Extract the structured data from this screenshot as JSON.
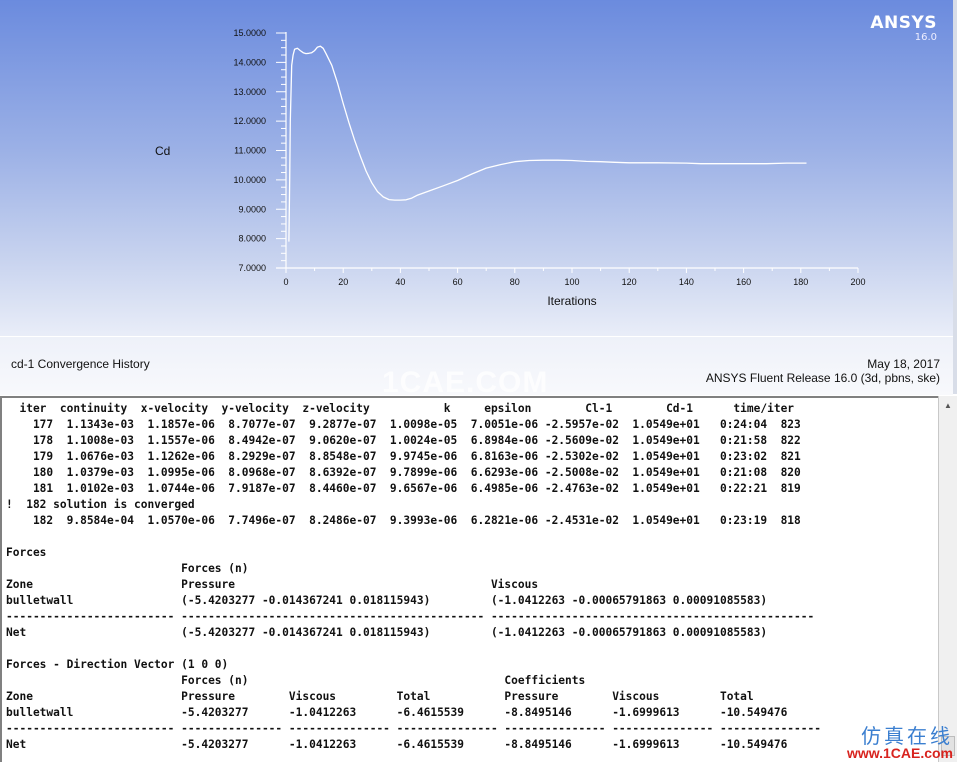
{
  "logo": {
    "name": "ANSYS",
    "version": "16.0"
  },
  "chart_data": {
    "type": "line",
    "title": "cd-1 Convergence History",
    "xlabel": "Iterations",
    "ylabel": "Cd",
    "xlim": [
      0,
      200
    ],
    "ylim": [
      7,
      15
    ],
    "x_ticks": [
      "0",
      "20",
      "40",
      "60",
      "80",
      "100",
      "120",
      "140",
      "160",
      "180",
      "200"
    ],
    "y_ticks": [
      "7.0000",
      "8.0000",
      "9.0000",
      "10.0000",
      "11.0000",
      "12.0000",
      "13.0000",
      "14.0000",
      "15.0000"
    ],
    "grid": false,
    "series": [
      {
        "name": "cd-1",
        "color": "#ffffff",
        "x": [
          1,
          1.3,
          1.5,
          2,
          2.5,
          3,
          4,
          5,
          6,
          7,
          8,
          9,
          10,
          11,
          12,
          13,
          14,
          16,
          18,
          20,
          22,
          24,
          26,
          28,
          30,
          32,
          34,
          36,
          38,
          40,
          42,
          44,
          46,
          50,
          55,
          60,
          65,
          70,
          75,
          80,
          85,
          90,
          95,
          100,
          105,
          110,
          115,
          120,
          130,
          140,
          145,
          150,
          160,
          168,
          175,
          182
        ],
        "y": [
          7.9,
          10.0,
          12.0,
          13.9,
          14.25,
          14.45,
          14.48,
          14.4,
          14.33,
          14.3,
          14.31,
          14.33,
          14.4,
          14.52,
          14.55,
          14.48,
          14.3,
          13.9,
          13.3,
          12.6,
          11.95,
          11.35,
          10.8,
          10.3,
          9.9,
          9.6,
          9.42,
          9.33,
          9.31,
          9.31,
          9.32,
          9.38,
          9.48,
          9.62,
          9.8,
          9.98,
          10.2,
          10.4,
          10.52,
          10.62,
          10.66,
          10.67,
          10.67,
          10.66,
          10.63,
          10.62,
          10.6,
          10.58,
          10.58,
          10.57,
          10.55,
          10.55,
          10.55,
          10.55,
          10.57,
          10.57
        ]
      }
    ]
  },
  "caption": {
    "title": "cd-1 Convergence History",
    "date": "May 18, 2017",
    "release": "ANSYS Fluent Release 16.0 (3d, pbns, ske)",
    "watermark": "1CAE.COM"
  },
  "console": {
    "residual_header": [
      "iter",
      "continuity",
      "x-velocity",
      "y-velocity",
      "z-velocity",
      "k",
      "epsilon",
      "Cl-1",
      "Cd-1",
      "time/iter"
    ],
    "residual_rows": [
      [
        "177",
        "1.1343e-03",
        "1.1857e-06",
        "8.7077e-07",
        "9.2877e-07",
        "1.0098e-05",
        "7.0051e-06",
        "-2.5957e-02",
        "1.0549e+01",
        "0:24:04",
        "823"
      ],
      [
        "178",
        "1.1008e-03",
        "1.1557e-06",
        "8.4942e-07",
        "9.0620e-07",
        "1.0024e-05",
        "6.8984e-06",
        "-2.5609e-02",
        "1.0549e+01",
        "0:21:58",
        "822"
      ],
      [
        "179",
        "1.0676e-03",
        "1.1262e-06",
        "8.2929e-07",
        "8.8548e-07",
        "9.9745e-06",
        "6.8163e-06",
        "-2.5302e-02",
        "1.0549e+01",
        "0:23:02",
        "821"
      ],
      [
        "180",
        "1.0379e-03",
        "1.0995e-06",
        "8.0968e-07",
        "8.6392e-07",
        "9.7899e-06",
        "6.6293e-06",
        "-2.5008e-02",
        "1.0549e+01",
        "0:21:08",
        "820"
      ],
      [
        "181",
        "1.0102e-03",
        "1.0744e-06",
        "7.9187e-07",
        "8.4460e-07",
        "9.6567e-06",
        "6.4985e-06",
        "-2.4763e-02",
        "1.0549e+01",
        "0:22:21",
        "819"
      ]
    ],
    "converged_message": "!  182 solution is converged",
    "final_row": [
      "182",
      "9.8584e-04",
      "1.0570e-06",
      "7.7496e-07",
      "8.2486e-07",
      "9.3993e-06",
      "6.2821e-06",
      "-2.4531e-02",
      "1.0549e+01",
      "0:23:19",
      "818"
    ],
    "forces": {
      "title": "Forces",
      "subheader": "Forces (n)",
      "zone_label": "Zone",
      "pressure_label": "Pressure",
      "viscous_label": "Viscous",
      "zone": "bulletwall",
      "pressure": "(-5.4203277 -0.014367241 0.018115943)",
      "viscous": "(-1.0412263 -0.00065791863 0.00091085583)",
      "net_label": "Net",
      "net_pressure": "(-5.4203277 -0.014367241 0.018115943)",
      "net_viscous": "(-1.0412263 -0.00065791863 0.00091085583)"
    },
    "direction_forces": {
      "title": "Forces - Direction Vector (1 0 0)",
      "forces_header": "Forces (n)",
      "coeff_header": "Coefficients",
      "columns": [
        "Zone",
        "Pressure",
        "Viscous",
        "Total",
        "Pressure",
        "Viscous",
        "Total"
      ],
      "zone_row": [
        "bulletwall",
        "-5.4203277",
        "-1.0412263",
        "-6.4615539",
        "-8.8495146",
        "-1.6999613",
        "-10.549476"
      ],
      "net_row": [
        "Net",
        "-5.4203277",
        "-1.0412263",
        "-6.4615539",
        "-8.8495146",
        "-1.6999613",
        "-10.549476"
      ]
    }
  },
  "site_mark": {
    "cn": "仿真在线",
    "url": "www.1CAE.com"
  },
  "scrollbar": {
    "up_icon": "▲"
  }
}
